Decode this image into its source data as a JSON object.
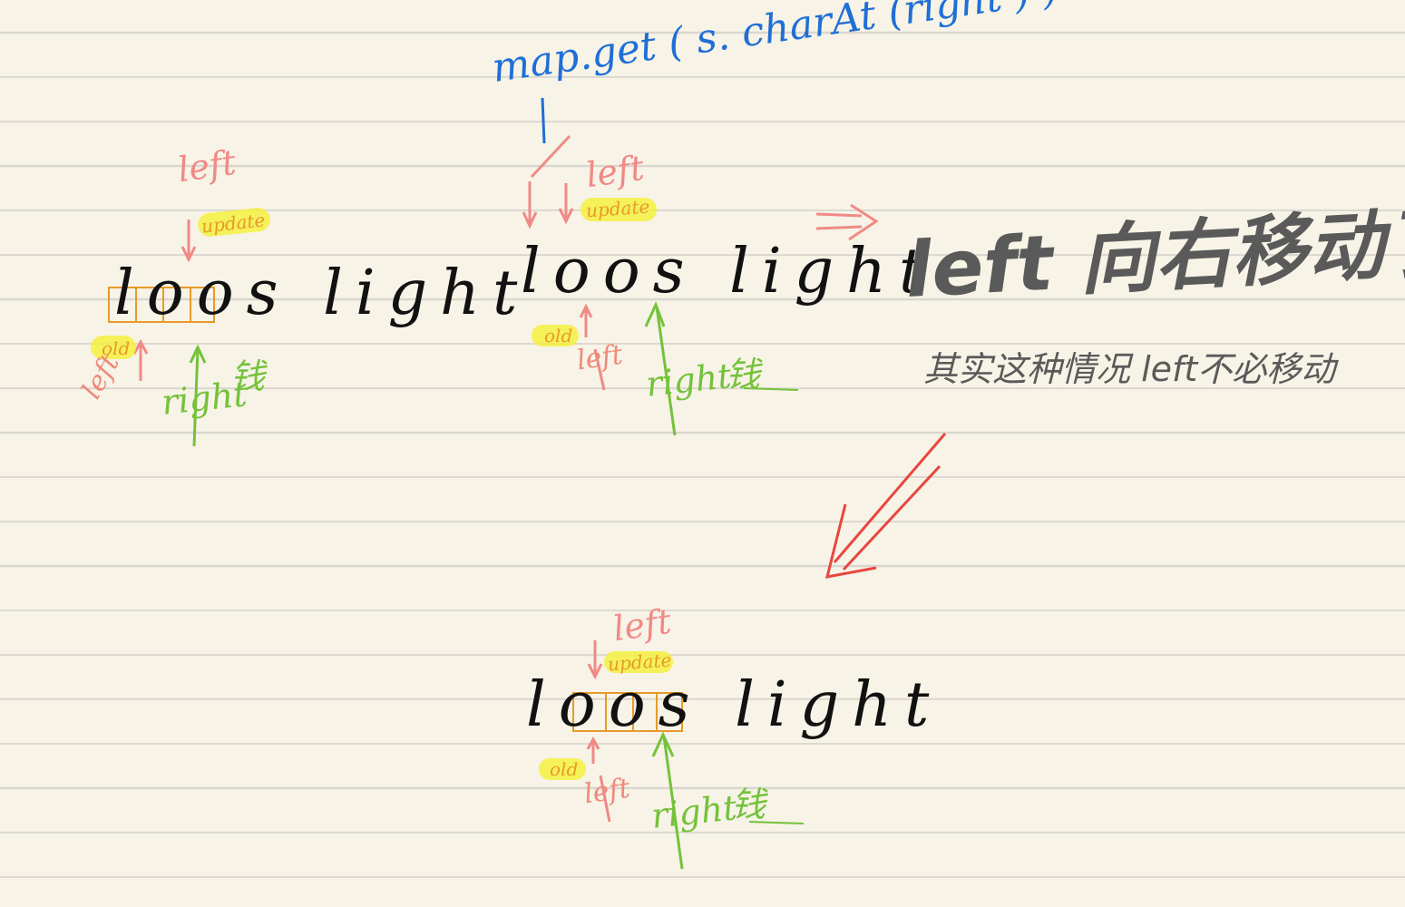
{
  "colors": {
    "paper": "#f7f3e7",
    "rule": "#d9d6cf",
    "ink": "#111111",
    "pointer_left": "#f08a86",
    "pointer_right": "#74c23a",
    "highlight": "#f5f03e",
    "window_box": "#e89a2a",
    "annotation": "#1f6fd6",
    "note": "#5a5a5a",
    "big_arrow": "#e8463f"
  },
  "annotation_top": "map.get ( s. charAt (right ) )",
  "step1": {
    "word": "loos light",
    "left_top": "left",
    "update": "update",
    "old": "old",
    "left_bottom": "left",
    "right": "right",
    "right_cn": "钱"
  },
  "step2": {
    "word": "loos light",
    "left_top": "left",
    "update": "update",
    "old": "old",
    "left_bottom": "left",
    "right": "right",
    "right_cn": "钱"
  },
  "step3": {
    "word": "loos light",
    "left_top": "left",
    "update": "update",
    "old": "old",
    "left_bottom": "left",
    "right": "right",
    "right_cn": "钱"
  },
  "note": {
    "arrow": "=>",
    "heading": "left 向右移动了",
    "sub": "其实这种情况 left不必移动"
  }
}
